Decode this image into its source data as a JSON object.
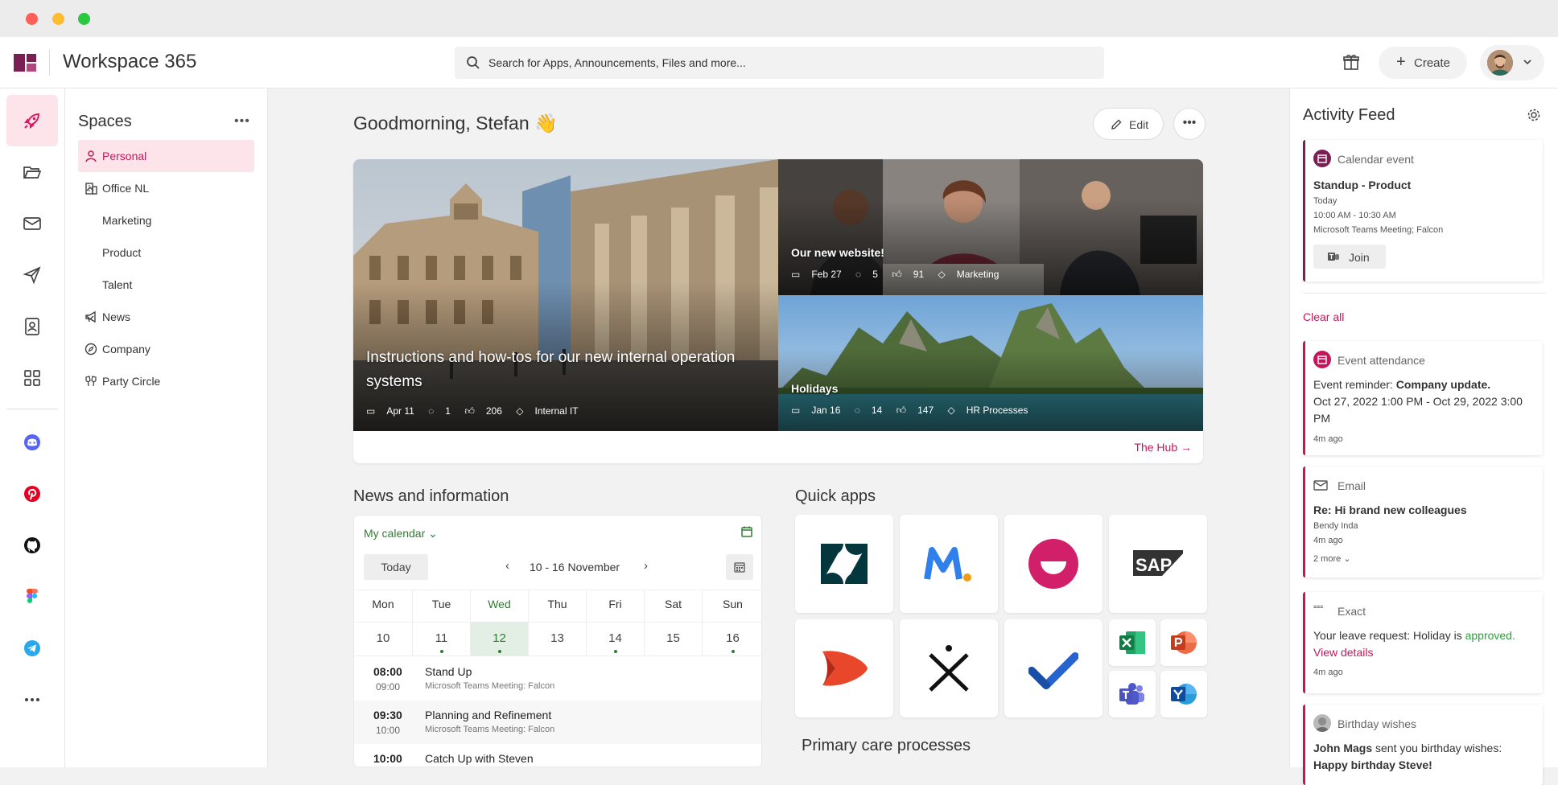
{
  "app": {
    "title": "Workspace 365"
  },
  "search": {
    "text": "Search for Apps, Announcements, Files and more..."
  },
  "header": {
    "create_label": "Create"
  },
  "spaces": {
    "title": "Spaces",
    "items": [
      {
        "label": "Personal"
      },
      {
        "label": "Office NL"
      },
      {
        "label": "Marketing"
      },
      {
        "label": "Product"
      },
      {
        "label": "Talent"
      },
      {
        "label": "News"
      },
      {
        "label": "Company"
      },
      {
        "label": "Party Circle"
      }
    ]
  },
  "main": {
    "greeting": "Goodmorning, Stefan 👋",
    "edit_label": "Edit",
    "hub_link": "The Hub",
    "hero": [
      {
        "title": "Instructions and how-tos for our new internal operation systems",
        "date": "Apr 11",
        "comments": "1",
        "likes": "206",
        "tag": "Internal IT"
      },
      {
        "title": "Our new website!",
        "date": "Feb 27",
        "comments": "5",
        "likes": "91",
        "tag": "Marketing"
      },
      {
        "title": "Holidays",
        "date": "Jan 16",
        "comments": "14",
        "likes": "147",
        "tag": "HR Processes"
      }
    ],
    "news_title": "News and information",
    "quick_apps_title": "Quick apps",
    "primary_care_title": "Primary care processes"
  },
  "calendar": {
    "selector": "My calendar",
    "today_label": "Today",
    "range": "10 - 16 November",
    "days": [
      {
        "name": "Mon",
        "date": "10"
      },
      {
        "name": "Tue",
        "date": "11"
      },
      {
        "name": "Wed",
        "date": "12"
      },
      {
        "name": "Thu",
        "date": "13"
      },
      {
        "name": "Fri",
        "date": "14"
      },
      {
        "name": "Sat",
        "date": "15"
      },
      {
        "name": "Sun",
        "date": "16"
      }
    ],
    "events": [
      {
        "start": "08:00",
        "end": "09:00",
        "title": "Stand Up",
        "location": "Microsoft Teams Meeting: Falcon"
      },
      {
        "start": "09:30",
        "end": "10:00",
        "title": "Planning and Refinement",
        "location": "Microsoft Teams Meeting: Falcon"
      },
      {
        "start": "10:00",
        "end": "",
        "title": "Catch Up with Steven",
        "location": ""
      }
    ]
  },
  "quick_apps": [
    "zendesk",
    "monday",
    "mentimeter",
    "sap",
    "visma",
    "ixpert",
    "todo",
    "excel",
    "powerpoint",
    "teams",
    "yammer"
  ],
  "feed": {
    "title": "Activity Feed",
    "clear_all": "Clear all",
    "calendar_event": {
      "type": "Calendar event",
      "title": "Standup - Product",
      "day": "Today",
      "time": "10:00 AM - 10:30 AM",
      "location": "Microsoft Teams Meeting; Falcon",
      "join": "Join"
    },
    "attendance": {
      "type": "Event attendance",
      "prefix": "Event reminder:",
      "subject": "Company update.",
      "range1": "Oct 27, 2022 1:00 PM - Oct 29, 2022 3:00",
      "range2": "PM",
      "ago": "4m ago"
    },
    "email": {
      "type": "Email",
      "subject": "Re: Hi brand new colleagues",
      "sender": "Bendy Inda",
      "ago": "4m ago",
      "more": "2 more"
    },
    "exact": {
      "type": "Exact",
      "text": "Your leave request: Holiday is",
      "status": "approved.",
      "link": "View details",
      "ago": "4m ago"
    },
    "birthday": {
      "type": "Birthday wishes",
      "from": "John Mags",
      "text": "sent you birthday wishes:",
      "wish": "Happy birthday Steve!"
    }
  },
  "colors": {
    "accent": "#c2185b",
    "brand": "#7a1f52",
    "calendar_green": "#2e7d32"
  }
}
